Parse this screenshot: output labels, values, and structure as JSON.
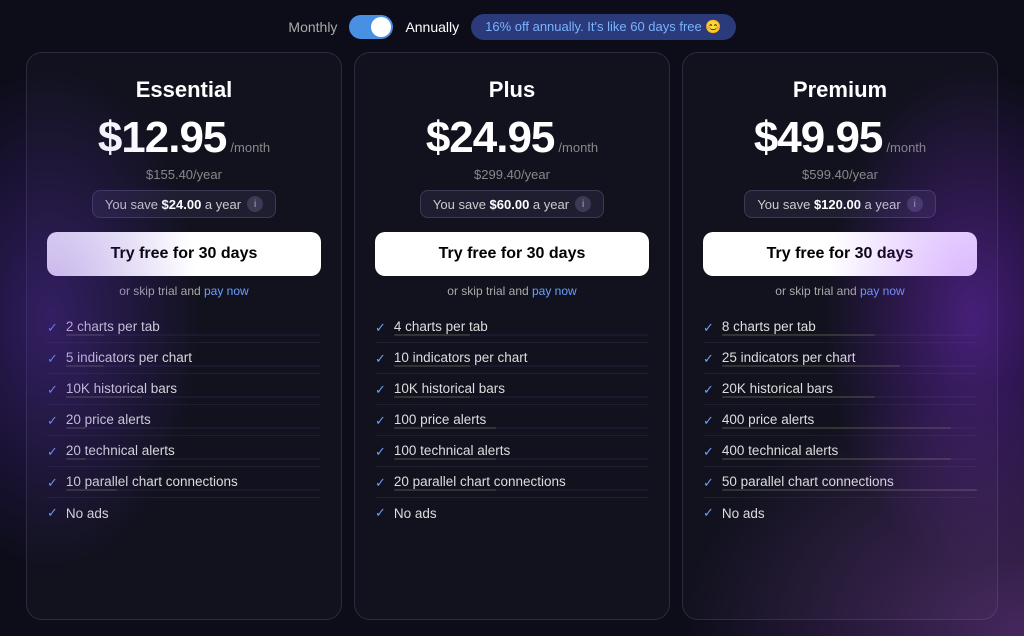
{
  "billing": {
    "monthly_label": "Monthly",
    "annually_label": "Annually",
    "discount_text": "16% off annually. It's like 60 days free 😊"
  },
  "plans": [
    {
      "id": "essential",
      "name": "Essential",
      "price": "$12.95",
      "per_month": "/month",
      "yearly": "$155.40/year",
      "savings": "You save $24.00 a year",
      "cta": "Try free for 30 days",
      "skip_text": "or skip trial and ",
      "skip_link": "pay now",
      "features": [
        {
          "text": "2 charts per tab",
          "bar": 15
        },
        {
          "text": "5 indicators per chart",
          "bar": 15
        },
        {
          "text": "10K historical bars",
          "bar": 30
        },
        {
          "text": "20 price alerts",
          "bar": 8
        },
        {
          "text": "20 technical alerts",
          "bar": 8
        },
        {
          "text": "10 parallel chart connections",
          "bar": 20
        },
        {
          "text": "No ads",
          "bar": 0
        }
      ]
    },
    {
      "id": "plus",
      "name": "Plus",
      "price": "$24.95",
      "per_month": "/month",
      "yearly": "$299.40/year",
      "savings": "You save $60.00 a year",
      "cta": "Try free for 30 days",
      "skip_text": "or skip trial and ",
      "skip_link": "pay now",
      "features": [
        {
          "text": "4 charts per tab",
          "bar": 30
        },
        {
          "text": "10 indicators per chart",
          "bar": 30
        },
        {
          "text": "10K historical bars",
          "bar": 30
        },
        {
          "text": "100 price alerts",
          "bar": 40
        },
        {
          "text": "100 technical alerts",
          "bar": 40
        },
        {
          "text": "20 parallel chart connections",
          "bar": 40
        },
        {
          "text": "No ads",
          "bar": 0
        }
      ]
    },
    {
      "id": "premium",
      "name": "Premium",
      "price": "$49.95",
      "per_month": "/month",
      "yearly": "$599.40/year",
      "savings": "You save $120.00 a year",
      "cta": "Try free for 30 days",
      "skip_text": "or skip trial and ",
      "skip_link": "pay now",
      "features": [
        {
          "text": "8 charts per tab",
          "bar": 60
        },
        {
          "text": "25 indicators per chart",
          "bar": 70
        },
        {
          "text": "20K historical bars",
          "bar": 60
        },
        {
          "text": "400 price alerts",
          "bar": 90
        },
        {
          "text": "400 technical alerts",
          "bar": 90
        },
        {
          "text": "50 parallel chart connections",
          "bar": 100
        },
        {
          "text": "No ads",
          "bar": 0
        }
      ]
    }
  ]
}
